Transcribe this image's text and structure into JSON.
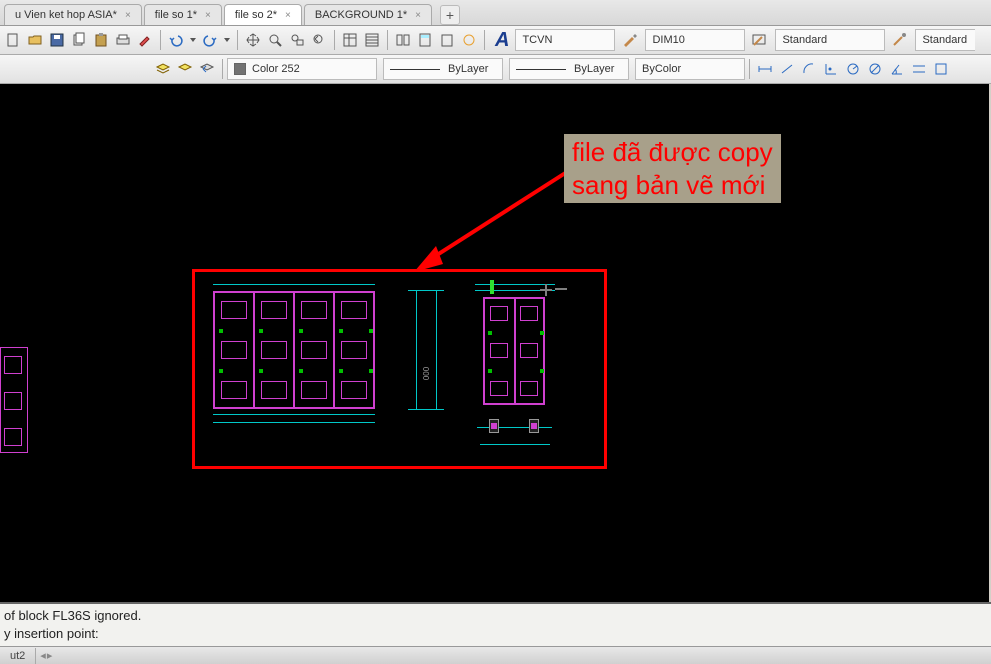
{
  "tabs": [
    {
      "label": "u Vien ket hop ASIA*",
      "active": false
    },
    {
      "label": "file so 1*",
      "active": false
    },
    {
      "label": "file so 2*",
      "active": true
    },
    {
      "label": "BACKGROUND 1*",
      "active": false
    }
  ],
  "new_tab_glyph": "+",
  "tab_close_glyph": "×",
  "toolbar_props": {
    "text_style": "TCVN",
    "dim_style": "DIM10",
    "table_style_1": "Standard",
    "table_style_2": "Standard",
    "color_label": "Color 252",
    "linetype": "ByLayer",
    "lineweight": "ByLayer",
    "plot_style": "ByColor"
  },
  "annotation": {
    "line1": "file đã được copy",
    "line2": "sang bản vẽ mới"
  },
  "command": {
    "line1": "of block FL36S  ignored.",
    "line2": "y insertion point:"
  },
  "status": {
    "layout_tab": "ut2"
  },
  "icons": {
    "new": "new-icon",
    "open": "open-icon",
    "save": "save-icon",
    "copy": "copy-icon",
    "paste": "paste-icon",
    "plot": "plot-icon",
    "undo": "undo-icon",
    "redo": "redo-icon",
    "pan": "pan-icon",
    "zoom": "zoom-icon",
    "zoomwin": "zoom-window-icon",
    "zoomprev": "zoom-prev-icon",
    "props": "properties-icon",
    "sheet": "sheet-icon",
    "tool": "tool-icon",
    "calc": "calc-icon",
    "paste2": "paste2-icon",
    "render": "render-icon",
    "brush": "brush-icon",
    "layers": "layer-stack-icon",
    "layerprev": "layer-prev-icon",
    "layeriso": "layer-iso-icon",
    "line": "line-icon",
    "ray": "ray-icon",
    "arc": "arc-icon",
    "dim": "dim-icon",
    "circ": "circle-icon",
    "rot": "rotate-icon",
    "mir": "mirror-icon",
    "grad": "gradient-icon"
  }
}
